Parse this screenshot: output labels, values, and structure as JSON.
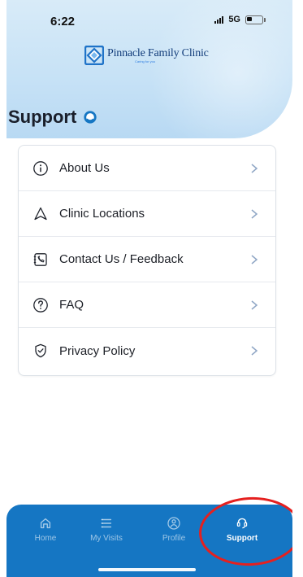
{
  "status_bar": {
    "time": "6:22",
    "network": "5G"
  },
  "brand": {
    "name": "Pinnacle Family Clinic",
    "tagline": "Caring for you"
  },
  "page": {
    "title": "Support"
  },
  "support_items": [
    {
      "label": "About Us",
      "icon": "info-circle-icon"
    },
    {
      "label": "Clinic Locations",
      "icon": "navigation-arrow-icon"
    },
    {
      "label": "Contact Us / Feedback",
      "icon": "contact-phone-icon"
    },
    {
      "label": "FAQ",
      "icon": "question-circle-icon"
    },
    {
      "label": "Privacy Policy",
      "icon": "shield-check-icon"
    }
  ],
  "bottom_nav": [
    {
      "label": "Home",
      "icon": "home-icon",
      "active": false
    },
    {
      "label": "My Visits",
      "icon": "list-icon",
      "active": false
    },
    {
      "label": "Profile",
      "icon": "profile-icon",
      "active": false
    },
    {
      "label": "Support",
      "icon": "headset-icon",
      "active": true
    }
  ],
  "colors": {
    "primary": "#1576C3",
    "header_tint": "#C7E2F6",
    "card_border": "#DDE2E8",
    "annotation_red": "#E5201F"
  }
}
